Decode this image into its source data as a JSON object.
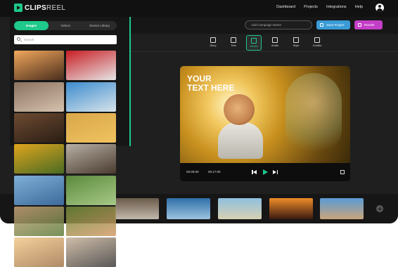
{
  "app": {
    "brand": "CLIPS",
    "brand_suffix": "REEL",
    "nav": [
      "Dashboard",
      "Projects",
      "Integrations",
      "Help"
    ]
  },
  "sidebar": {
    "tabs": [
      "Images",
      "Videos",
      "Stories Library"
    ],
    "active_tab": "Images",
    "search_placeholder": "Search",
    "images": [
      {
        "name": "friends-sunset-photo",
        "colors": [
          "#f1a75c",
          "#4a2e1d"
        ]
      },
      {
        "name": "heart-hands-photo",
        "colors": [
          "#c81e24",
          "#e6e6e6"
        ]
      },
      {
        "name": "couple-selfie-photo",
        "colors": [
          "#8a7260",
          "#d6c2ae"
        ]
      },
      {
        "name": "beach-walk-photo",
        "colors": [
          "#3d8ccf",
          "#d7e3ea"
        ]
      },
      {
        "name": "woman-laptop-photo",
        "colors": [
          "#6e4b32",
          "#2a1d14"
        ]
      },
      {
        "name": "red-umbrella-photo",
        "colors": [
          "#d9a74a",
          "#f0c35f"
        ]
      },
      {
        "name": "sunflower-girls-photo",
        "colors": [
          "#e0a51e",
          "#4a6b22"
        ]
      },
      {
        "name": "man-portrait-photo",
        "colors": [
          "#b8b0a5",
          "#4a3a2e"
        ]
      },
      {
        "name": "jumping-man-photo",
        "colors": [
          "#7fb0d8",
          "#3d6a9a"
        ]
      },
      {
        "name": "kids-running-photo",
        "colors": [
          "#5b8a3c",
          "#a7c987"
        ]
      },
      {
        "name": "kids-smiling-photo",
        "colors": [
          "#c9a27a",
          "#5d7e3b"
        ]
      },
      {
        "name": "girl-bubbles-photo",
        "colors": [
          "#6d8a36",
          "#d59a6a"
        ]
      },
      {
        "name": "group-silhouette-photo",
        "colors": [
          "#f1c98a",
          "#a3754c"
        ]
      },
      {
        "name": "crowd-festival-photo",
        "colors": [
          "#c7b29a",
          "#3d3a39"
        ]
      }
    ]
  },
  "toolbar": {
    "campaign_placeholder": "Add Campaign Name",
    "save_label": "Save Project",
    "render_label": "Render",
    "tools": [
      "Story",
      "Text",
      "Media",
      "Audio",
      "Style",
      "Credits"
    ],
    "active_tool": "Media"
  },
  "preview": {
    "overlay_text_line1": "YOUR",
    "overlay_text_line2": "TEXT HERE",
    "current_time": "00:00:00",
    "total_time": "00:17:00"
  },
  "timeline": {
    "clips": [
      {
        "name": "car-clip",
        "colors": [
          "#6a5a4a",
          "#c2b8ad"
        ]
      },
      {
        "name": "ocean-waves-clip",
        "colors": [
          "#2f6fa8",
          "#9cc3e0"
        ]
      },
      {
        "name": "beach-person-clip",
        "colors": [
          "#8fc0de",
          "#d8d0b4"
        ]
      },
      {
        "name": "sunset-clip",
        "colors": [
          "#f08c2a",
          "#3a1a10"
        ]
      },
      {
        "name": "rock-sky-clip",
        "colors": [
          "#5a9ad5",
          "#c9a57a"
        ]
      }
    ]
  }
}
